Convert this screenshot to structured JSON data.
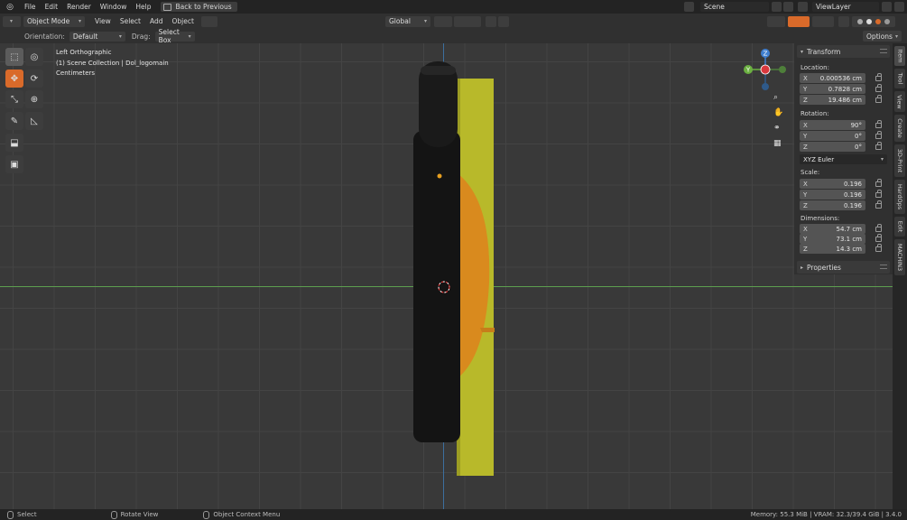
{
  "topbar": {
    "menus": [
      "File",
      "Edit",
      "Render",
      "Window",
      "Help"
    ],
    "back_to_previous": "Back to Previous",
    "scene": "Scene",
    "view_layer": "ViewLayer"
  },
  "header": {
    "mode": "Object Mode",
    "menus": [
      "View",
      "Select",
      "Add",
      "Object"
    ],
    "transform_orientation": "Global"
  },
  "tool_settings": {
    "orientation_label": "Orientation:",
    "orientation_value": "Default",
    "drag_label": "Drag:",
    "drag_value": "Select Box",
    "options": "Options"
  },
  "viewport": {
    "view_name": "Left Orthographic",
    "collection": "(1) Scene Collection | Dol_logomain",
    "units": "Centimeters",
    "gizmo": {
      "z": "Z",
      "y": "Y"
    }
  },
  "sidebar": {
    "transform_title": "Transform",
    "location_label": "Location:",
    "location": [
      {
        "axis": "X",
        "value": "0.000536 cm"
      },
      {
        "axis": "Y",
        "value": "0.7828 cm"
      },
      {
        "axis": "Z",
        "value": "19.486 cm"
      }
    ],
    "rotation_label": "Rotation:",
    "rotation": [
      {
        "axis": "X",
        "value": "90°"
      },
      {
        "axis": "Y",
        "value": "0°"
      },
      {
        "axis": "Z",
        "value": "0°"
      }
    ],
    "rotation_mode": "XYZ Euler",
    "scale_label": "Scale:",
    "scale": [
      {
        "axis": "X",
        "value": "0.196"
      },
      {
        "axis": "Y",
        "value": "0.196"
      },
      {
        "axis": "Z",
        "value": "0.196"
      }
    ],
    "dimensions_label": "Dimensions:",
    "dimensions": [
      {
        "axis": "X",
        "value": "54.7 cm"
      },
      {
        "axis": "Y",
        "value": "73.1 cm"
      },
      {
        "axis": "Z",
        "value": "14.3 cm"
      }
    ],
    "properties_title": "Properties"
  },
  "tabs": [
    "Item",
    "Tool",
    "View",
    "Create",
    "3D-Print",
    "HardOps",
    "Edit",
    "MACHIN3"
  ],
  "statusbar": {
    "select": "Select",
    "rotate_view": "Rotate View",
    "context_menu": "Object Context Menu",
    "memory": "Memory: 55.3 MiB | VRAM: 32.3/39.4 GiB | 3.4.0"
  },
  "colors": {
    "accent": "#d96a2a",
    "object_dark": "#141414",
    "logo_yellow": "#b8b92a",
    "logo_orange": "#d98a1e",
    "axis_x": "#5d9e4f",
    "axis_z": "#3c6f9e"
  }
}
